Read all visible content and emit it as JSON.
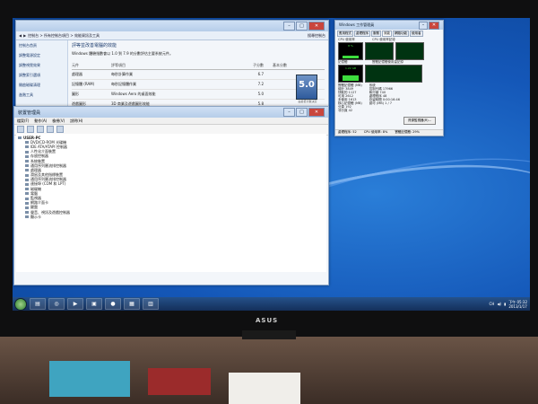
{
  "monitor_brand": "ASUS",
  "rating_window": {
    "address": "控制台 > 所有控制台項目 > 效能資訊及工具",
    "search_placeholder": "搜尋控制台",
    "sidebar": [
      "控制台首頁",
      "調整電源設定",
      "調整視覺效果",
      "調整索引選項",
      "開啟磁碟清理",
      "進階工具"
    ],
    "title": "評等並改善電腦的效能",
    "subtitle": "Windows 體驗指數會以 1.0 到 7.9 的分數評估主要系統元件。",
    "headers": [
      "元件",
      "評等項目",
      "子分數",
      "基本分數"
    ],
    "rows": [
      {
        "component": "處理器",
        "desc": "每秒計算作業",
        "score": "6.7"
      },
      {
        "component": "記憶體 (RAM)",
        "desc": "每秒記憶體作業",
        "score": "7.2"
      },
      {
        "component": "圖形",
        "desc": "Windows Aero 的桌面效能",
        "score": "5.0"
      },
      {
        "component": "遊戲圖形",
        "desc": "3D 商業及遊戲圖形效能",
        "score": "5.8"
      },
      {
        "component": "主要硬碟",
        "desc": "磁碟資料傳輸速率",
        "score": "5.9"
      }
    ],
    "base_score": "5.0",
    "base_caption": "由最低分數決定"
  },
  "device_manager": {
    "title": "裝置管理員",
    "menu": [
      "檔案(F)",
      "動作(A)",
      "檢視(V)",
      "說明(H)"
    ],
    "root": "USER-PC",
    "items": [
      "DVD/CD-ROM 光碟機",
      "IDE ATA/ATAPI 控制器",
      "人性化介面裝置",
      "存放控制器",
      "系統裝置",
      "通用序列匯流排控制器",
      "處理器",
      "滑鼠及其他指標裝置",
      "通用序列匯流排控制器",
      "連接埠 (COM 和 LPT)",
      "磁碟機",
      "電腦",
      "監視器",
      "網路介面卡",
      "鍵盤",
      "聲音、視訊及遊戲控制器",
      "顯示卡"
    ]
  },
  "task_manager": {
    "title": "Windows 工作管理員",
    "tabs": [
      "應用程式",
      "處理程序",
      "服務",
      "效能",
      "網路功能",
      "使用者"
    ],
    "active_tab": "效能",
    "labels": {
      "cpu": "CPU 使用率",
      "cpu_hist": "CPU 使用率記錄",
      "mem": "記憶體",
      "mem_hist": "實體記憶體使用量記錄"
    },
    "cpu_pct": "8 %",
    "mem_val": "1.22 GB",
    "phys_header": "實體記憶體 (MB)",
    "phys": [
      [
        "總計",
        "3849"
      ],
      [
        "快取的",
        "1127"
      ],
      [
        "可用",
        "2612"
      ],
      [
        "未使用",
        "1613"
      ]
    ],
    "system_header": "系統",
    "system": [
      [
        "控制代碼",
        "17966"
      ],
      [
        "執行緒",
        "740"
      ],
      [
        "處理程序",
        "48"
      ],
      [
        "存留時間",
        "0:00:16:46"
      ],
      [
        "認可 (MB)",
        "1 / 7"
      ]
    ],
    "kernel_header": "核心記憶體 (MB)",
    "kernel": [
      [
        "分頁",
        "192"
      ],
      [
        "非分頁",
        "42"
      ]
    ],
    "resource_button": "資源監視器(R)...",
    "status": [
      "處理程序: 52",
      "CPU 使用率: 8%",
      "實體記憶體: 29%"
    ]
  },
  "taskbar": {
    "time": "下午 05:32",
    "date": "2013/1/17",
    "lang": "CH"
  }
}
